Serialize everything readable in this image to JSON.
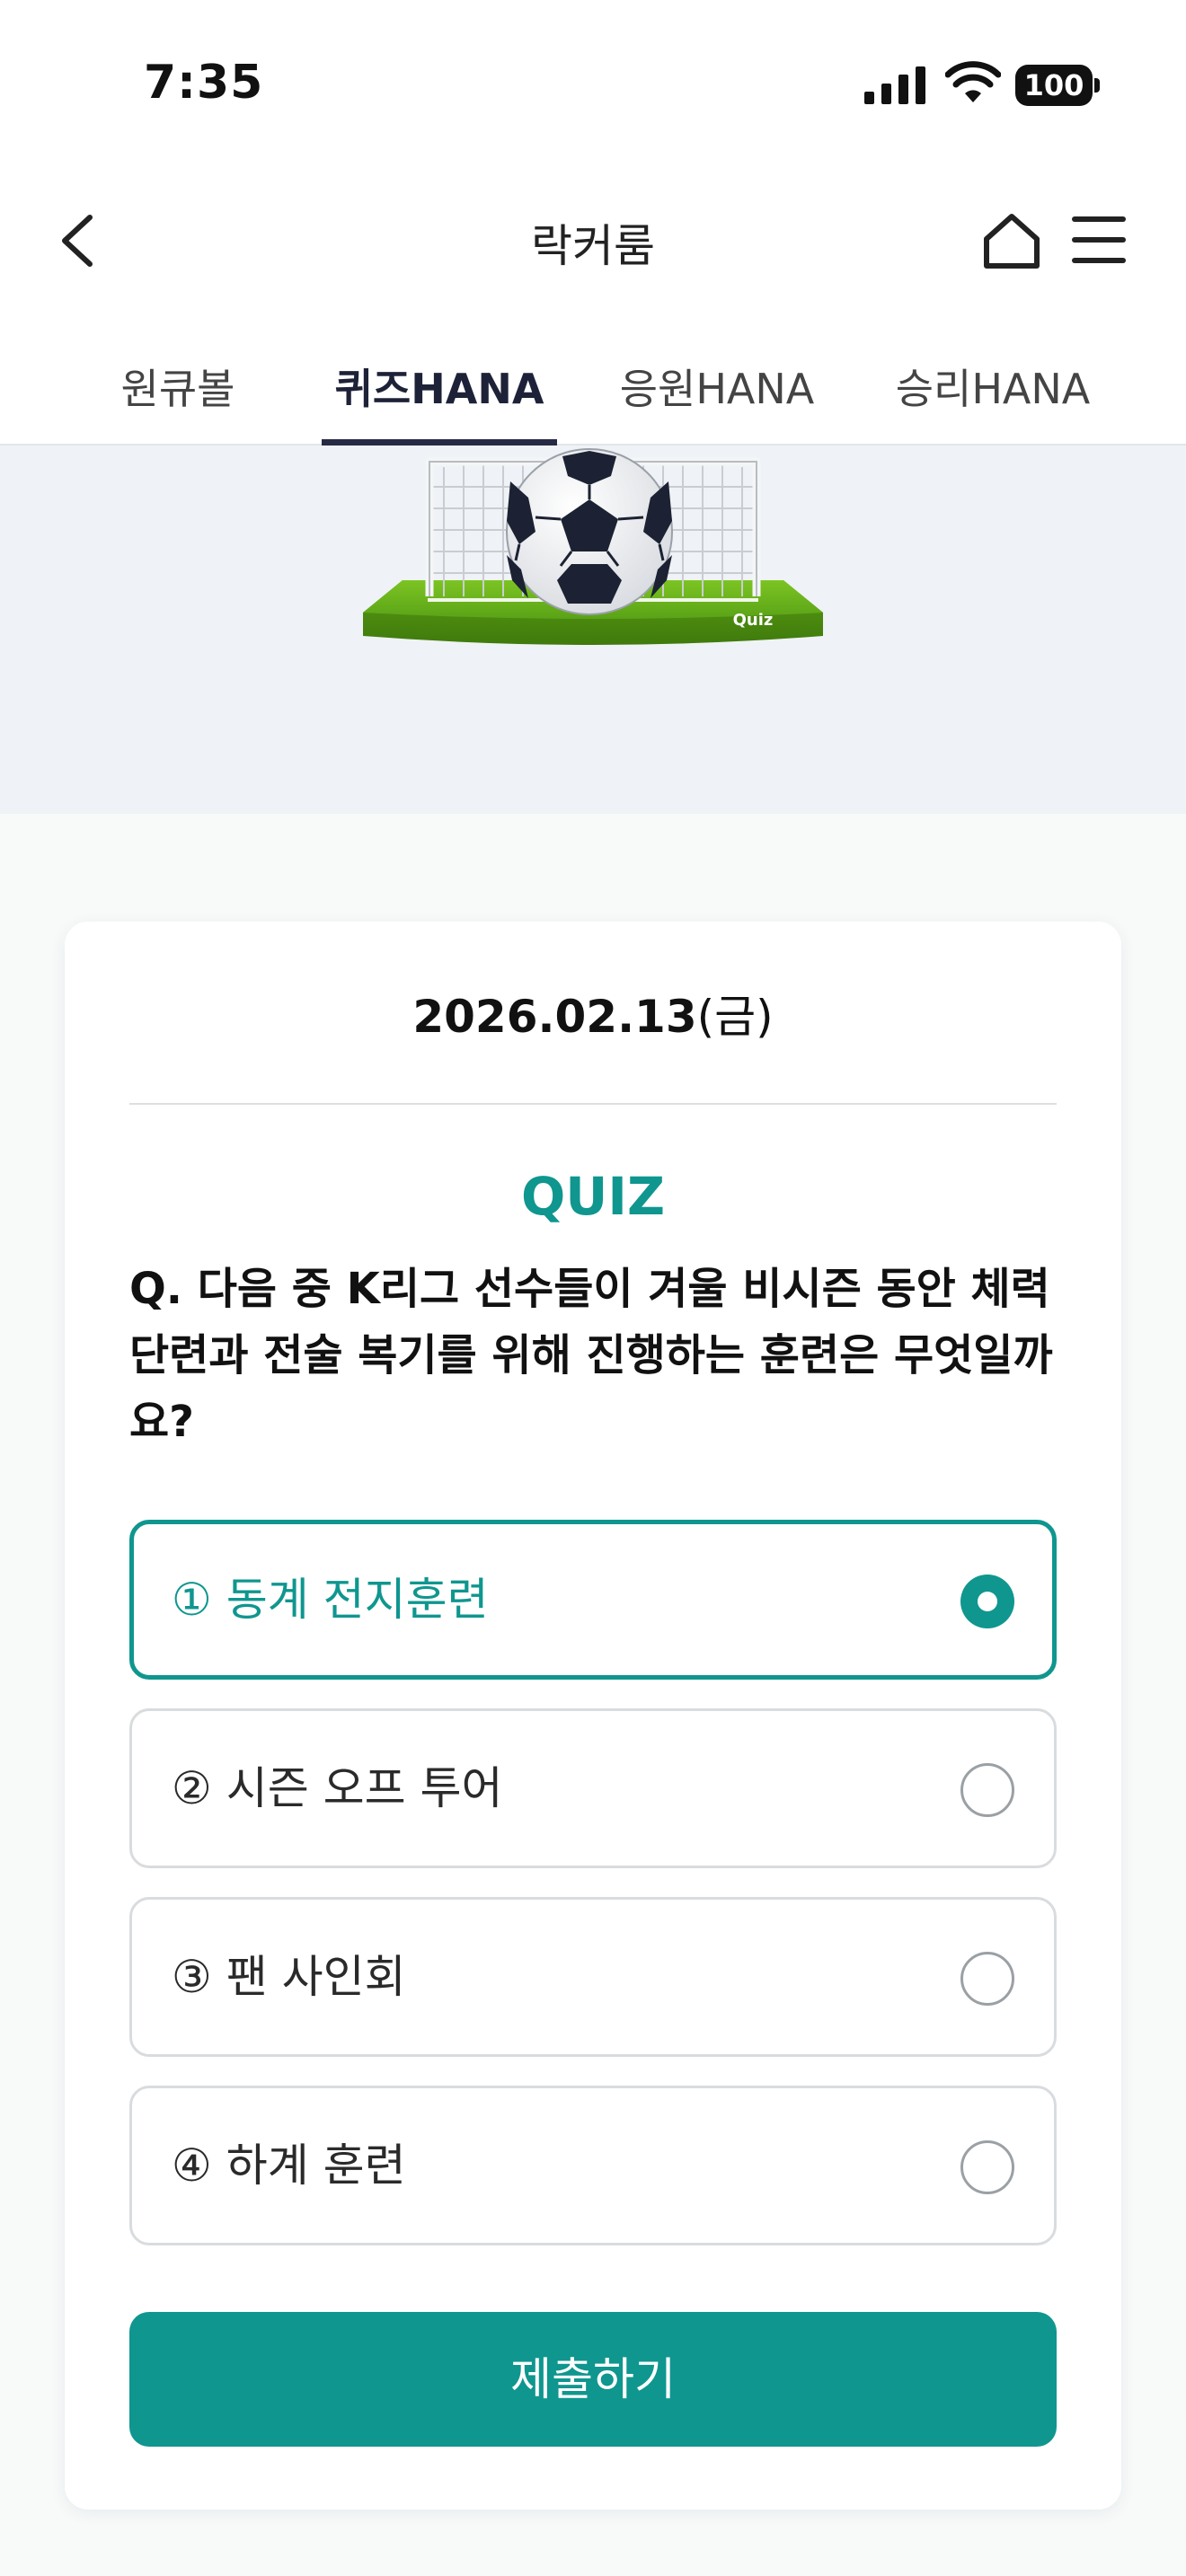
{
  "status_bar": {
    "time": "7:35",
    "battery": "100"
  },
  "header": {
    "title": "락커룸"
  },
  "tabs": [
    {
      "label": "원큐볼",
      "active": false
    },
    {
      "label": "퀴즈HANA",
      "active": true
    },
    {
      "label": "응원HANA",
      "active": false
    },
    {
      "label": "승리HANA",
      "active": false
    }
  ],
  "banner": {
    "art_text": "Quiz"
  },
  "quiz": {
    "date": "2026.02.13",
    "day_of_week": "(금)",
    "label": "QUIZ",
    "question": "Q. 다음 중 K리그 선수들이 겨울 비시즌 동안 체력 단련과 전술 복기를 위해 진행하는 훈련은 무엇일까요?",
    "options": [
      {
        "label": "① 동계 전지훈련",
        "selected": true
      },
      {
        "label": "② 시즌 오프 투어",
        "selected": false
      },
      {
        "label": "③ 팬 사인회",
        "selected": false
      },
      {
        "label": "④ 하계 훈련",
        "selected": false
      }
    ],
    "submit_label": "제출하기"
  },
  "colors": {
    "accent": "#0f968f",
    "tab_active": "#262a44",
    "banner_bg": "#eff2f6",
    "page_bg": "#f8fafa"
  }
}
